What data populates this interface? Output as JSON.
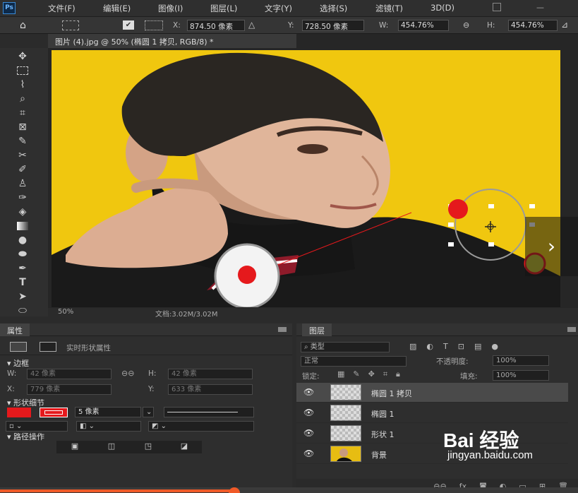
{
  "menu": {
    "logo": "Ps",
    "items": [
      "文件(F)",
      "编辑(E)",
      "图像(I)",
      "图层(L)",
      "文字(Y)",
      "选择(S)",
      "滤镜(T)",
      "3D(D)"
    ]
  },
  "options": {
    "x_label": "X:",
    "x_value": "874.50 像素",
    "y_label": "Y:",
    "y_value": "728.50 像素",
    "w_label": "W:",
    "w_value": "454.76%",
    "h_label": "H:",
    "h_value": "454.76%"
  },
  "doc_tab": "图片 (4).jpg @ 50% (椭圆 1 拷贝, RGB/8) *",
  "status": {
    "zoom": "50%",
    "doc": "文档:3.02M/3.02M"
  },
  "properties": {
    "tab": "属性",
    "subtitle": "实时形状属性",
    "bbox_section": "边框",
    "w_label": "W:",
    "w_value": "42 像素",
    "h_label": "H:",
    "h_value": "42 像素",
    "x_label": "X:",
    "x_value": "779 像素",
    "y_label": "Y:",
    "y_value": "633 像素",
    "shape_section": "形状细节",
    "stroke_width": "5 像素",
    "path_section": "路径操作",
    "fill_color": "#e5191c"
  },
  "layers": {
    "tab": "图层",
    "filter": "类型",
    "blend_mode": "正常",
    "opacity_label": "不透明度:",
    "opacity_value": "100%",
    "lock_label": "锁定:",
    "fill_label": "填充:",
    "fill_value": "100%",
    "rows": [
      {
        "name": "椭圆 1 拷贝",
        "selected": true
      },
      {
        "name": "椭圆 1",
        "selected": false
      },
      {
        "name": "形状 1",
        "selected": false
      },
      {
        "name": "背景",
        "selected": false
      }
    ]
  },
  "watermark": {
    "brand": "Bai  经验",
    "url": "jingyan.baidu.com"
  },
  "colors": {
    "accent_red": "#e5191c",
    "background_yellow": "#f0c70f"
  }
}
